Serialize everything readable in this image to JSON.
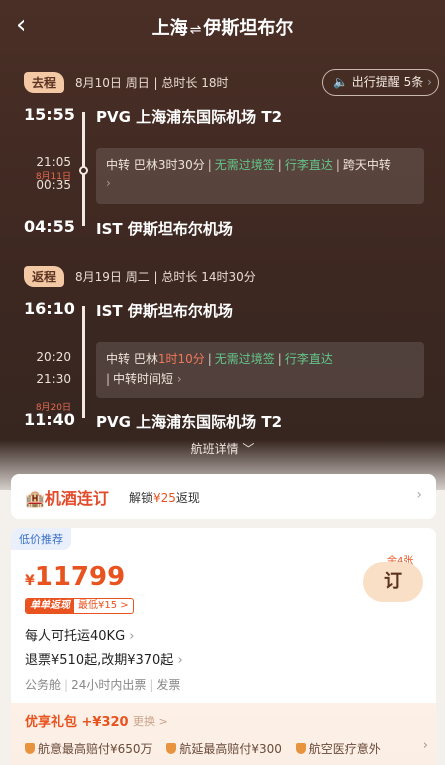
{
  "header": {
    "back_icon": "‹",
    "title_from": "上海",
    "title_sep": "⇌",
    "title_to": "伊斯坦布尔"
  },
  "outbound": {
    "badge": "去程",
    "info": "8月10日 周日 | 总时长 18时",
    "remind_label": "出行提醒 5条",
    "dep_time": "15:55",
    "dep_airport": "PVG 上海浦东国际机场 T2",
    "transfer_arr_time": "21:05",
    "transfer_dep_date": "8月11日",
    "transfer_dep_time": "00:35",
    "transfer_city": "中转 巴林3时30分",
    "transfer_visa": "无需过境签",
    "transfer_luggage": "行李直达",
    "transfer_note": "跨天中转",
    "arr_time": "04:55",
    "arr_airport": "IST 伊斯坦布尔机场"
  },
  "return": {
    "badge": "返程",
    "info": "8月19日 周二 | 总时长 14时30分",
    "dep_time": "16:10",
    "dep_airport": "IST 伊斯坦布尔机场",
    "transfer_arr_time": "20:20",
    "transfer_dep_time": "21:30",
    "transfer_city": "中转 巴林",
    "transfer_duration": "1时10分",
    "transfer_visa": "无需过境签",
    "transfer_luggage": "行李直达",
    "transfer_note": "中转时间短",
    "arr_date": "8月20日",
    "arr_time": "11:40",
    "arr_airport": "PVG 上海浦东国际机场 T2"
  },
  "detail_link": "航班详情 ﹀",
  "promo": {
    "brand": "机酒连订",
    "text_prefix": "解锁",
    "amount": "¥25",
    "text_suffix": "返现"
  },
  "offer": {
    "tag": "低价推荐",
    "currency": "¥",
    "price": "11799",
    "remain": "余4张",
    "book_label": "订",
    "single_tag": "单单返现",
    "single_tag_detail": "最低¥15 >",
    "luggage": "每人可托运40KG",
    "refund": "退票¥510起,改期¥370起",
    "features": [
      "公务舱",
      "24小时内出票",
      "发票"
    ],
    "gift_title": "优享礼包 +¥320",
    "gift_change": "更换 >",
    "gift_items": [
      "航意最高赔付¥650万",
      "航延最高赔付¥300",
      "航空医疗意外"
    ]
  },
  "colors": {
    "accent": "#e8531f",
    "brown_bg": "#3d2821",
    "green": "#64c58a"
  }
}
